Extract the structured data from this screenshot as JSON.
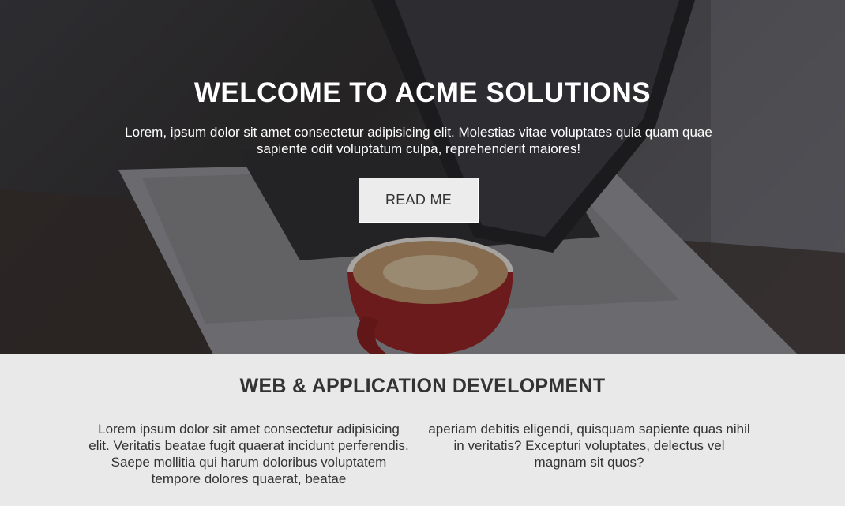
{
  "hero": {
    "title": "WELCOME TO ACME SOLUTIONS",
    "text": "Lorem, ipsum dolor sit amet consectetur adipisicing elit. Molestias vitae voluptates quia quam quae sapiente odit voluptatum culpa, reprehenderit maiores!",
    "button_label": "READ ME"
  },
  "section": {
    "title": "WEB & APPLICATION DEVELOPMENT",
    "column_left": "Lorem ipsum dolor sit amet consectetur adipisicing elit. Veritatis beatae fugit quaerat incidunt perferendis. Saepe mollitia qui harum doloribus voluptatem tempore dolores quaerat, beatae",
    "column_right": "aperiam debitis eligendi, quisquam sapiente quas nihil in veritatis? Excepturi voluptates, delectus vel magnam sit quos?"
  },
  "colors": {
    "section_background": "#e9e9e9",
    "text_dark": "#333333",
    "button_background": "#ececec"
  }
}
